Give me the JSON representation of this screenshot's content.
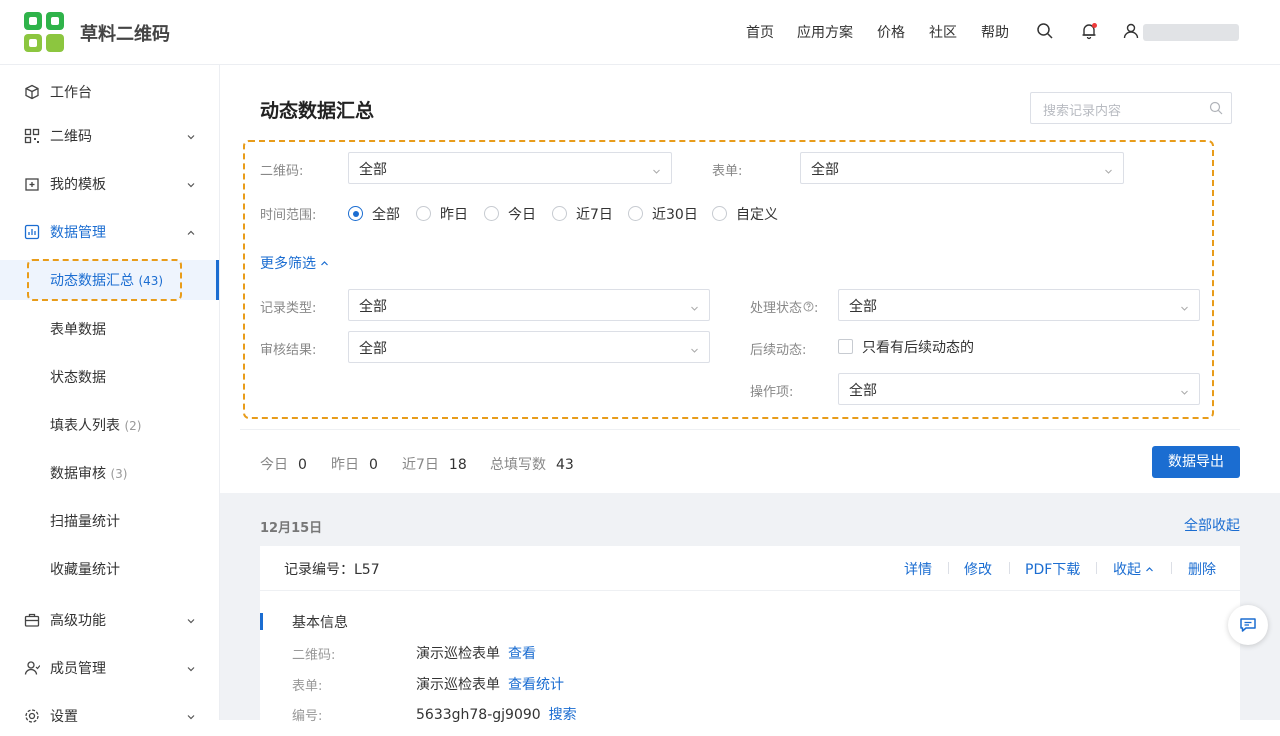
{
  "brand": {
    "name": "草料二维码",
    "colors": {
      "green": "#2fb34a",
      "lime": "#8cc63f"
    }
  },
  "topnav": {
    "items": [
      "首页",
      "应用方案",
      "价格",
      "社区",
      "帮助"
    ],
    "icons": [
      "search-icon",
      "bell-icon",
      "user-icon"
    ]
  },
  "sidebar": {
    "items": [
      {
        "label": "工作台",
        "icon": "cube-icon"
      },
      {
        "label": "二维码",
        "icon": "qr-icon"
      },
      {
        "label": "我的模板",
        "icon": "template-icon"
      },
      {
        "label": "数据管理",
        "icon": "chart-icon"
      }
    ],
    "sub": [
      {
        "label": "动态数据汇总",
        "count": "(43)"
      },
      {
        "label": "表单数据",
        "count": ""
      },
      {
        "label": "状态数据",
        "count": ""
      },
      {
        "label": "填表人列表",
        "count": "(2)"
      },
      {
        "label": "数据审核",
        "count": "(3)"
      },
      {
        "label": "扫描量统计",
        "count": ""
      },
      {
        "label": "收藏量统计",
        "count": ""
      }
    ],
    "bottom": [
      {
        "label": "高级功能",
        "icon": "briefcase-icon"
      },
      {
        "label": "成员管理",
        "icon": "member-icon"
      },
      {
        "label": "设置",
        "icon": "settings-icon"
      }
    ]
  },
  "page": {
    "title": "动态数据汇总",
    "search_placeholder": "搜索记录内容"
  },
  "filters": {
    "qrcode": {
      "label": "二维码:",
      "value": "全部"
    },
    "form": {
      "label": "表单:",
      "value": "全部"
    },
    "time": {
      "label": "时间范围:",
      "options": [
        "全部",
        "昨日",
        "今日",
        "近7日",
        "近30日",
        "自定义"
      ],
      "selected": "全部"
    },
    "more": "更多筛选",
    "record_type": {
      "label": "记录类型:",
      "value": "全部"
    },
    "process_status": {
      "label": "处理状态",
      "value": "全部"
    },
    "review_result": {
      "label": "审核结果:",
      "value": "全部"
    },
    "follow": {
      "label": "后续动态:",
      "checkbox_label": "只看有后续动态的",
      "checked": false
    },
    "operation": {
      "label": "操作项:",
      "value": "全部"
    }
  },
  "stats": {
    "today_label": "今日",
    "today": "0",
    "yesterday_label": "昨日",
    "yesterday": "0",
    "week_label": "近7日",
    "week": "18",
    "total_label": "总填写数",
    "total": "43",
    "export_label": "数据导出"
  },
  "records": {
    "date": "12月15日",
    "collapse_all": "全部收起",
    "item": {
      "record_no": "记录编号：L57",
      "actions": [
        "详情",
        "修改",
        "PDF下载",
        "收起",
        "删除"
      ],
      "section_title": "基本信息",
      "fields": [
        {
          "key": "二维码:",
          "value": "演示巡检表单",
          "link": "查看"
        },
        {
          "key": "表单:",
          "value": "演示巡检表单",
          "link": "查看统计"
        },
        {
          "key": "编号:",
          "value": "5633gh78-gj9090",
          "link": "搜索"
        }
      ]
    }
  },
  "accent_color": "#1b6dd1",
  "highlight_color": "#e89c1a"
}
